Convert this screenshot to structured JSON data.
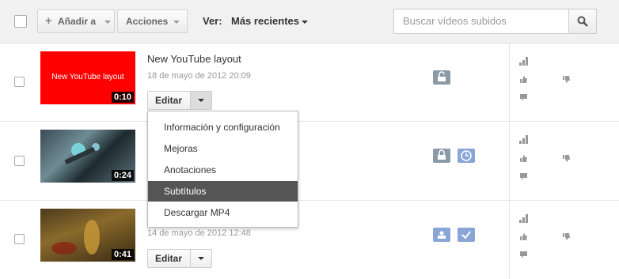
{
  "toolbar": {
    "add_to_label": "Añadir a",
    "actions_label": "Acciones",
    "view_label": "Ver:",
    "sort_value": "Más recientes",
    "search_placeholder": "Buscar vídeos subidos"
  },
  "videos": [
    {
      "thumb_text": "New YouTube layout",
      "duration": "0:10",
      "title": "New YouTube layout",
      "date": "18 de mayo de 2012 20:09",
      "edit_label": "Editar",
      "privacy": "public-icon"
    },
    {
      "duration": "0:24",
      "privacy": "private-icon",
      "status": "scheduled-clock-icon"
    },
    {
      "duration": "0:41",
      "date": "14 de mayo de 2012 12:48",
      "edit_label": "Editar",
      "privacy": "unlisted-icon",
      "status": "checkmark-icon"
    }
  ],
  "edit_menu": {
    "items": [
      "Información y configuración",
      "Mejoras",
      "Anotaciones",
      "Subtítulos",
      "Descargar MP4"
    ],
    "selected": "Subtítulos"
  },
  "colors": {
    "thumb_red": "#ff0000",
    "badge_gray": "#8c9aa8",
    "badge_blue": "#8aa6d6",
    "menu_selected": "#555555"
  }
}
